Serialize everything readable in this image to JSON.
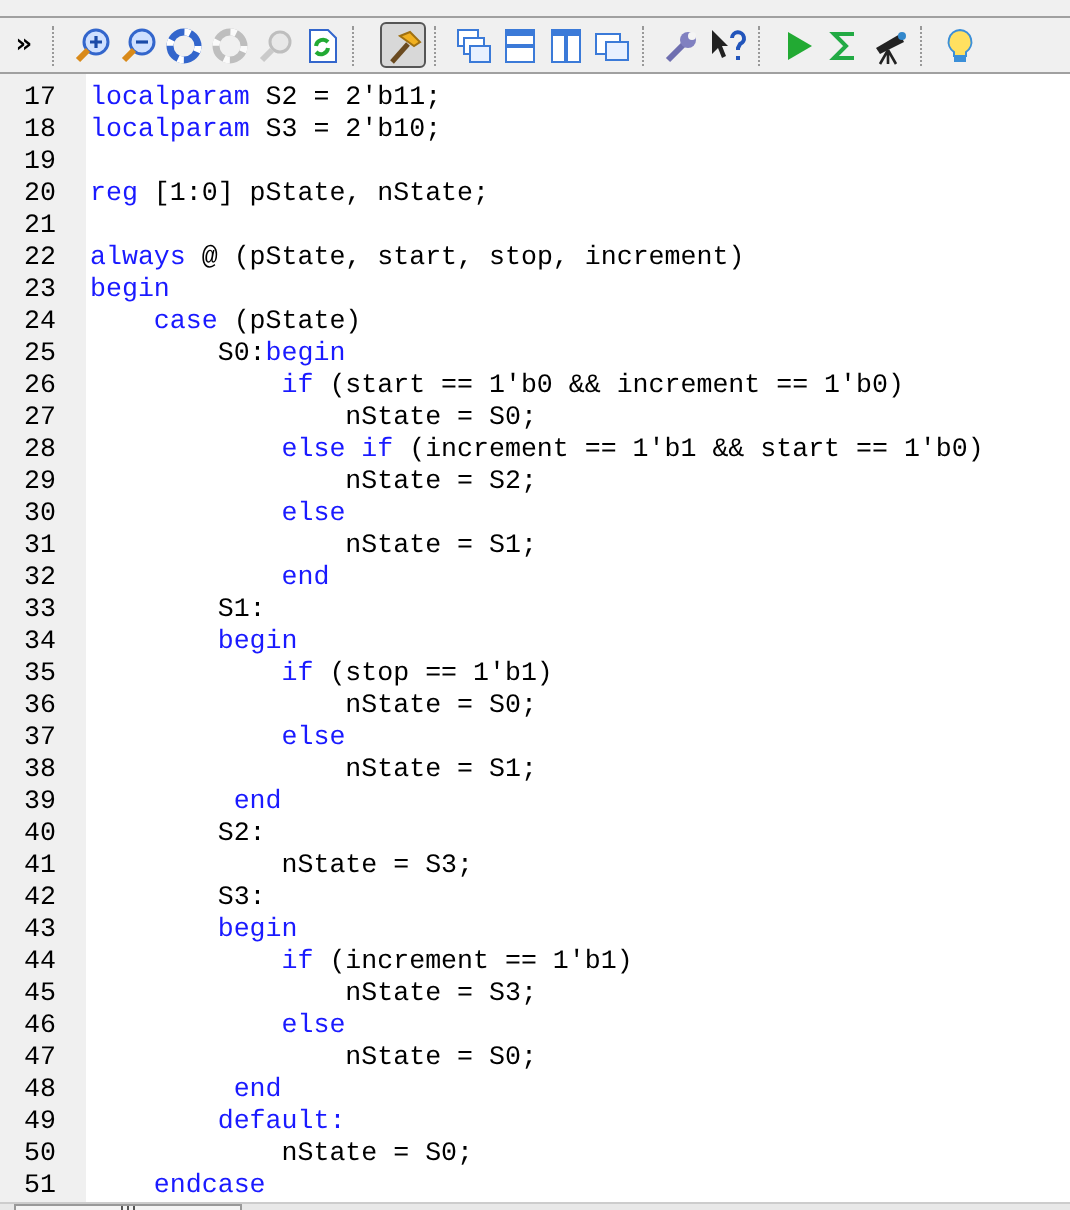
{
  "toolbar": {
    "overflow": "»",
    "groups": [
      [
        {
          "disabled": false,
          "pressed": false
        },
        {
          "disabled": false,
          "pressed": false
        },
        {
          "disabled": false,
          "pressed": false
        },
        {
          "disabled": true,
          "pressed": false
        },
        {
          "disabled": true,
          "pressed": false
        },
        {
          "disabled": false,
          "pressed": false
        }
      ],
      [
        {
          "disabled": false,
          "pressed": true
        }
      ],
      [
        {
          "disabled": false,
          "pressed": false
        },
        {
          "disabled": false,
          "pressed": false
        },
        {
          "disabled": false,
          "pressed": false
        },
        {
          "disabled": false,
          "pressed": false
        }
      ],
      [
        {
          "disabled": false,
          "pressed": false
        },
        {
          "disabled": false,
          "pressed": false
        }
      ],
      [
        {
          "disabled": false,
          "pressed": false
        },
        {
          "disabled": false,
          "pressed": false
        },
        {
          "disabled": false,
          "pressed": false
        }
      ],
      [
        {
          "disabled": false,
          "pressed": false
        }
      ]
    ]
  },
  "lines": [
    {
      "number": "17",
      "tokens": [
        {
          "kind": "keyword",
          "text": "localparam"
        },
        {
          "kind": "plain",
          "text": " S2 = 2'b11;"
        }
      ]
    },
    {
      "number": "18",
      "tokens": [
        {
          "kind": "keyword",
          "text": "localparam"
        },
        {
          "kind": "plain",
          "text": " S3 = 2'b10;"
        }
      ]
    },
    {
      "number": "19"
    },
    {
      "number": "20",
      "tokens": [
        {
          "kind": "keyword",
          "text": "reg"
        },
        {
          "kind": "plain",
          "text": " [1:0] pState, nState;"
        }
      ]
    },
    {
      "number": "21"
    },
    {
      "number": "22",
      "tokens": [
        {
          "kind": "keyword",
          "text": "always"
        },
        {
          "kind": "plain",
          "text": " @ (pState, start, stop, increment)"
        }
      ]
    },
    {
      "number": "23",
      "tokens": [
        {
          "kind": "keyword",
          "text": "begin"
        }
      ]
    },
    {
      "number": "24",
      "tokens": [
        {
          "kind": "keyword",
          "text": "    case"
        },
        {
          "kind": "plain",
          "text": " (pState)"
        }
      ]
    },
    {
      "number": "25",
      "tokens": [
        {
          "kind": "plain",
          "text": "        S0:"
        },
        {
          "kind": "keyword",
          "text": "begin"
        }
      ]
    },
    {
      "number": "26",
      "tokens": [
        {
          "kind": "keyword",
          "text": "            if"
        },
        {
          "kind": "plain",
          "text": " (start == 1'b0 && increment == 1'b0)"
        }
      ]
    },
    {
      "number": "27",
      "tokens": [
        {
          "kind": "plain",
          "text": "                nState = S0;"
        }
      ]
    },
    {
      "number": "28",
      "tokens": [
        {
          "kind": "keyword",
          "text": "            else if"
        },
        {
          "kind": "plain",
          "text": " (increment == 1'b1 && start == 1'b0)"
        }
      ]
    },
    {
      "number": "29",
      "tokens": [
        {
          "kind": "plain",
          "text": "                nState = S2;"
        }
      ]
    },
    {
      "number": "30",
      "tokens": [
        {
          "kind": "keyword",
          "text": "            else"
        }
      ]
    },
    {
      "number": "31",
      "tokens": [
        {
          "kind": "plain",
          "text": "                nState = S1;"
        }
      ]
    },
    {
      "number": "32",
      "tokens": [
        {
          "kind": "keyword",
          "text": "            end"
        }
      ]
    },
    {
      "number": "33",
      "tokens": [
        {
          "kind": "plain",
          "text": "        S1:"
        }
      ]
    },
    {
      "number": "34",
      "tokens": [
        {
          "kind": "keyword",
          "text": "        begin"
        }
      ]
    },
    {
      "number": "35",
      "tokens": [
        {
          "kind": "keyword",
          "text": "            if"
        },
        {
          "kind": "plain",
          "text": " (stop == 1'b1)"
        }
      ]
    },
    {
      "number": "36",
      "tokens": [
        {
          "kind": "plain",
          "text": "                nState = S0;"
        }
      ]
    },
    {
      "number": "37",
      "tokens": [
        {
          "kind": "keyword",
          "text": "            else"
        }
      ]
    },
    {
      "number": "38",
      "tokens": [
        {
          "kind": "plain",
          "text": "                nState = S1;"
        }
      ]
    },
    {
      "number": "39",
      "tokens": [
        {
          "kind": "keyword",
          "text": "         end"
        }
      ]
    },
    {
      "number": "40",
      "tokens": [
        {
          "kind": "plain",
          "text": "        S2:"
        }
      ]
    },
    {
      "number": "41",
      "tokens": [
        {
          "kind": "plain",
          "text": "            nState = S3;"
        }
      ]
    },
    {
      "number": "42",
      "tokens": [
        {
          "kind": "plain",
          "text": "        S3:"
        }
      ]
    },
    {
      "number": "43",
      "tokens": [
        {
          "kind": "keyword",
          "text": "        begin"
        }
      ]
    },
    {
      "number": "44",
      "tokens": [
        {
          "kind": "keyword",
          "text": "            if"
        },
        {
          "kind": "plain",
          "text": " (increment == 1'b1)"
        }
      ]
    },
    {
      "number": "45",
      "tokens": [
        {
          "kind": "plain",
          "text": "                nState = S3;"
        }
      ]
    },
    {
      "number": "46",
      "tokens": [
        {
          "kind": "keyword",
          "text": "            else"
        }
      ]
    },
    {
      "number": "47",
      "tokens": [
        {
          "kind": "plain",
          "text": "                nState = S0;"
        }
      ]
    },
    {
      "number": "48",
      "tokens": [
        {
          "kind": "keyword",
          "text": "         end"
        }
      ]
    },
    {
      "number": "49",
      "tokens": [
        {
          "kind": "keyword",
          "text": "        default:"
        }
      ]
    },
    {
      "number": "50",
      "tokens": [
        {
          "kind": "plain",
          "text": "            nState = S0;"
        }
      ]
    },
    {
      "number": "51",
      "tokens": [
        {
          "kind": "keyword",
          "text": "    endcase"
        }
      ]
    }
  ]
}
